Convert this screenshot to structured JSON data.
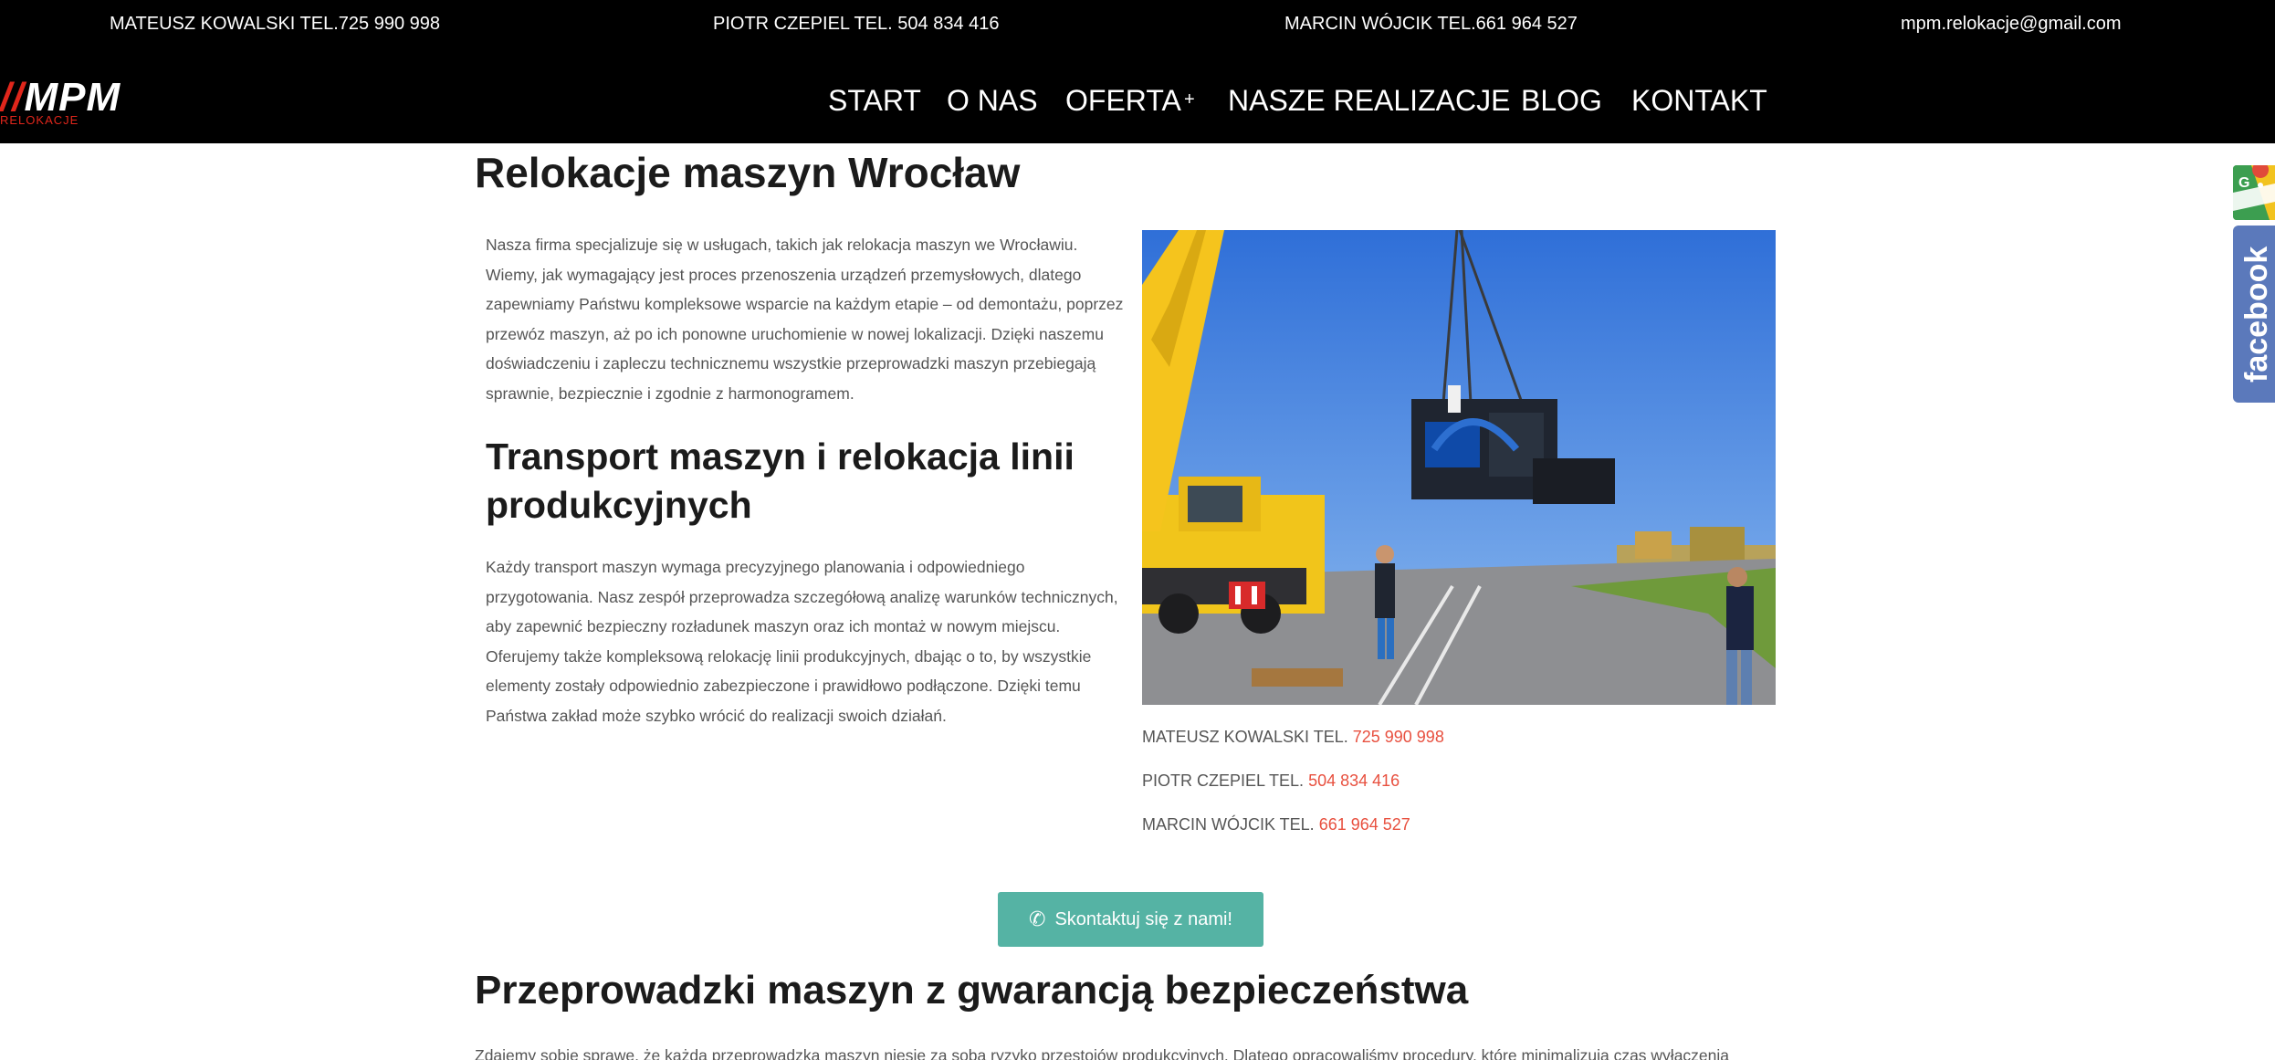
{
  "topbar": {
    "contact1": "MATEUSZ KOWALSKI TEL.725 990 998",
    "contact2": "PIOTR CZEPIEL TEL. 504 834 416",
    "contact3": "MARCIN WÓJCIK TEL.661 964 527",
    "email": "mpm.relokacje@gmail.com"
  },
  "logo": {
    "text": "MPM",
    "slash": "//",
    "subtitle": "RELOKACJE"
  },
  "nav": {
    "items": [
      "START",
      "O NAS",
      "OFERTA",
      "NASZE REALIZACJE",
      "BLOG",
      "KONTAKT"
    ],
    "dropdown_marker": "+"
  },
  "main": {
    "title": "Relokacje maszyn Wrocław",
    "paragraph1": "Nasza firma specjalizuje się w usługach, takich jak relokacja maszyn we Wrocławiu. Wiemy, jak wymagający jest proces przenoszenia urządzeń przemysłowych, dlatego zapewniamy Państwu kompleksowe wsparcie na każdym etapie – od demontażu, poprzez przewóz maszyn, aż po ich ponowne uruchomienie w nowej lokalizacji. Dzięki naszemu doświadczeniu i zapleczu technicznemu wszystkie przeprowadzki maszyn przebiegają sprawnie, bezpiecznie i zgodnie z harmonogramem.",
    "subtitle": "Transport maszyn i relokacja linii produkcyjnych",
    "paragraph2": "Każdy transport maszyn wymaga precyzyjnego planowania i odpowiedniego przygotowania. Nasz zespół przeprowadza szczegółową analizę warunków technicznych, aby zapewnić bezpieczny rozładunek maszyn oraz ich montaż w nowym miejscu. Oferujemy także kompleksową relokację linii produkcyjnych, dbając o to, by wszystkie elementy zostały odpowiednio zabezpieczone i prawidłowo podłączone. Dzięki temu Państwa zakład może szybko wrócić do realizacji swoich działań.",
    "contacts": [
      {
        "label": "MATEUSZ KOWALSKI TEL.",
        "number": "725 990 998"
      },
      {
        "label": "PIOTR CZEPIEL TEL.",
        "number": "504 834 416"
      },
      {
        "label": "MARCIN WÓJCIK TEL.",
        "number": "661 964 527"
      }
    ],
    "cta_label": "Skontaktuj się z nami!",
    "section2_title": "Przeprowadzki maszyn z gwarancją bezpieczeństwa",
    "paragraph3": "Zdajemy sobie sprawę, że każda przeprowadzka maszyn niesie za sobą ryzyko przestojów produkcyjnych. Dlatego opracowaliśmy procedury, które minimalizują czas wyłączenia"
  },
  "widgets": {
    "gmaps_letter": "G",
    "facebook": "facebook"
  },
  "colors": {
    "accent_red": "#e8503f",
    "cta": "#55b3a4",
    "facebook": "#5b79bb",
    "bar": "#000000"
  }
}
